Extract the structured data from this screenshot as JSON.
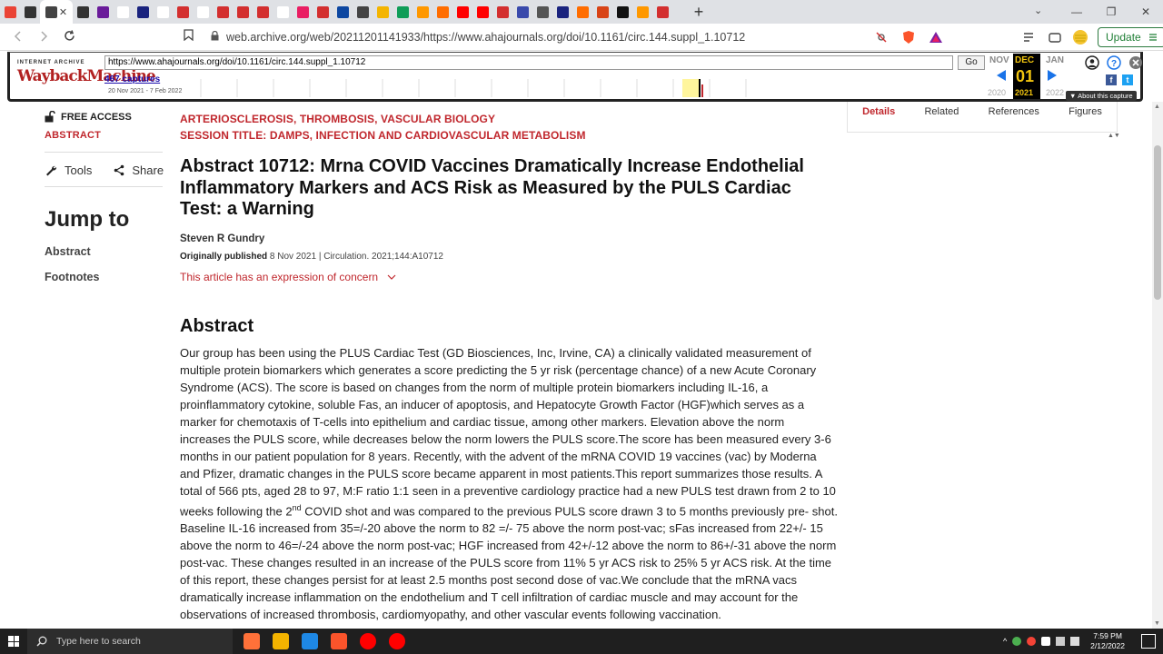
{
  "browser": {
    "tab_colors": [
      "#ea4335",
      "#333333",
      "#444444",
      "#333333",
      "#6a1b9a",
      "#ffffff",
      "#1a237e",
      "#ffffff",
      "#d32f2f",
      "#ffffff",
      "#d32f2f",
      "#d32f2f",
      "#d32f2f",
      "#ffffff",
      "#e91e63",
      "#d32f2f",
      "#0d47a1",
      "#444444",
      "#f4b400",
      "#0f9d58",
      "#ff9800",
      "#ff6d00",
      "#ff0000",
      "#ff0000",
      "#d32f2f",
      "#3949ab",
      "#555555",
      "#1a237e",
      "#ff6d00",
      "#d84315",
      "#111111",
      "#ff9800",
      "#d32f2f"
    ],
    "tab_close": "✕",
    "new_tab": "+",
    "tab_search": "⌄",
    "window_controls": [
      "—",
      "❐",
      "✕"
    ],
    "url": "web.archive.org/web/20211201141933/https://www.ahajournals.org/doi/10.1161/circ.144.suppl_1.10712",
    "update_label": "Update"
  },
  "wayback": {
    "logo_top": "INTERNET ARCHIVE",
    "logo": "WaybackMachine",
    "input_url": "https://www.ahajournals.org/doi/10.1161/circ.144.suppl_1.10712",
    "go_label": "Go",
    "captures": "467 captures",
    "date_range": "20 Nov 2021 - 7 Feb 2022",
    "prev_month": "NOV",
    "cur_month": "DEC",
    "next_month": "JAN",
    "cur_day": "01",
    "prev_year": "2020",
    "cur_year": "2021",
    "next_year": "2022",
    "about": "▼ About this capture"
  },
  "sidebar": {
    "free_access": "FREE ACCESS",
    "abstract_tag": "ABSTRACT",
    "tools": "Tools",
    "share": "Share",
    "jump_to": "Jump to",
    "links": [
      "Abstract",
      "Footnotes"
    ]
  },
  "article": {
    "kicker1": "ARTERIOSCLEROSIS, THROMBOSIS, VASCULAR BIOLOGY",
    "kicker2": "SESSION TITLE: DAMPS, INFECTION AND CARDIOVASCULAR METABOLISM",
    "title": "Abstract 10712: Mrna COVID Vaccines Dramatically Increase Endothelial Inflammatory Markers and ACS Risk as Measured by the PULS Cardiac Test: a Warning",
    "author": "Steven R Gundry",
    "published_label": "Originally published",
    "published_rest": " 8 Nov 2021 | Circulation. 2021;144:A10712",
    "concern": "This article has an expression of concern",
    "abstract_heading": "Abstract",
    "abstract_part1": "Our group has been using the PLUS Cardiac Test (GD Biosciences, Inc, Irvine, CA) a clinically validated measurement of multiple protein biomarkers which generates a score predicting the 5 yr risk (percentage chance) of a new Acute Coronary Syndrome (ACS). The score is based on changes from the norm of multiple protein biomarkers including IL-16, a proinflammatory cytokine, soluble Fas, an inducer of apoptosis, and Hepatocyte Growth Factor (HGF)which serves as a marker for chemotaxis of T-cells into epithelium and cardiac tissue, among other markers. Elevation above the norm increases the PULS score, while decreases below the norm lowers the PULS score.The score has been measured every 3-6 months in our patient population for 8 years. Recently, with the advent of the mRNA COVID 19 vaccines (vac) by Moderna and Pfizer, dramatic changes in the PULS score became apparent in most patients.This report summarizes those results. A total of 566 pts, aged 28 to 97, M:F ratio 1:1 seen in a preventive cardiology practice had a new PULS test drawn from 2 to 10 weeks following the 2",
    "abstract_sup": "nd",
    "abstract_part2": " COVID shot and was compared to the previous PULS score drawn 3 to 5 months previously pre- shot. Baseline IL-16 increased from 35=/-20 above the norm to 82 =/- 75 above the norm post-vac; sFas increased from 22+/- 15 above the norm to 46=/-24 above the norm post-vac; HGF increased from 42+/-12 above the norm to 86+/-31 above the norm post-vac. These changes resulted in an increase of the PULS score from 11% 5 yr ACS risk to 25% 5 yr ACS risk. At the time of this report, these changes persist for at least 2.5 months post second dose of vac.We conclude that the mRNA vacs dramatically increase inflammation on the endothelium and T cell infiltration of cardiac muscle and may account for the observations of increased thrombosis, cardiomyopathy, and other vascular events following vaccination."
  },
  "right_panel": {
    "tabs": [
      "Details",
      "Related",
      "References",
      "Figures"
    ]
  },
  "taskbar": {
    "search_placeholder": "Type here to search",
    "time": "7:59 PM",
    "date": "2/12/2022",
    "app_colors": [
      "#ff7139",
      "#f4b400",
      "#1e88e5",
      "#fb542b",
      "#ff0000",
      "#ff0000"
    ]
  },
  "colors": {
    "accent_red": "#c0272d",
    "wayback_yellow": "#f1c40f",
    "wayback_blue": "#1a73e8",
    "taskbar_bg": "#1f1f1f"
  }
}
